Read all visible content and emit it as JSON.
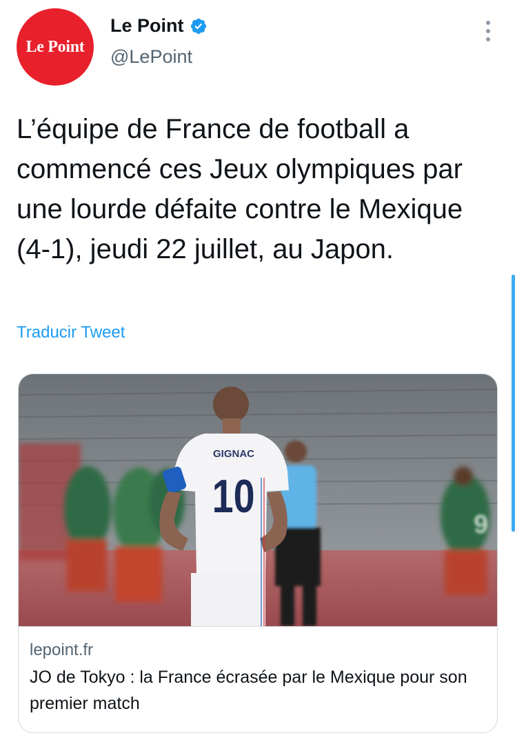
{
  "author": {
    "avatar_text": "Le Point",
    "display_name": "Le Point",
    "handle": "@LePoint",
    "verified": true
  },
  "tweet": {
    "text": "L’équipe de France de football a commencé ces Jeux olympiques par une lourde défaite contre le Mexique (4-1), jeudi 22 juillet, au Japon.",
    "translate_label": "Traducir Tweet"
  },
  "card": {
    "image": {
      "jersey_name": "GIGNAC",
      "jersey_number": "10",
      "opponent_number": "9"
    },
    "domain": "lepoint.fr",
    "title": "JO de Tokyo : la France écrasée par le Mexique pour son premier match"
  },
  "colors": {
    "brand_red": "#e8202b",
    "link_blue": "#1d9bf0",
    "verified_blue": "#1d9bf0",
    "secondary_text": "#536471"
  },
  "icons": {
    "verified": "verified-badge-icon",
    "more": "more-options-icon"
  }
}
